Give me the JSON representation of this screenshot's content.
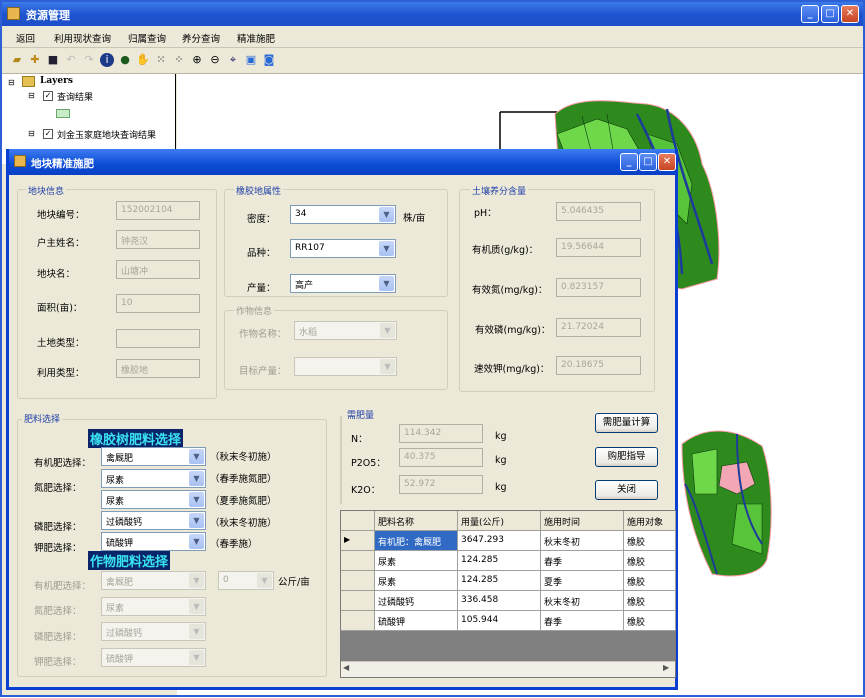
{
  "app": {
    "title": "资源管理"
  },
  "menu": [
    "返回",
    "利用现状查询",
    "归属查询",
    "养分查询",
    "精准施肥"
  ],
  "toc": {
    "root": "Layers",
    "layer1": "查询结果",
    "layer2": "刘金玉家庭地块查询结果"
  },
  "dialog": {
    "title": "地块精准施肥",
    "plot_info": {
      "group": "地块信息",
      "fields": [
        {
          "label": "地块编号：",
          "value": "152002104"
        },
        {
          "label": "户主姓名：",
          "value": "钟尧汉"
        },
        {
          "label": "地块名：",
          "value": "山塘冲"
        },
        {
          "label": "面积(亩)：",
          "value": "10"
        },
        {
          "label": "土地类型：",
          "value": ""
        },
        {
          "label": "利用类型：",
          "value": "橡胶地"
        }
      ]
    },
    "rubber": {
      "group": "橡胶地属性",
      "density": {
        "label": "密度：",
        "value": "34",
        "unit": "株/亩"
      },
      "variety": {
        "label": "品种：",
        "value": "RR107"
      },
      "yield": {
        "label": "产量：",
        "value": "高产"
      },
      "crop_group": "作物信息",
      "crop_name": {
        "label": "作物名称：",
        "value": "水稻"
      },
      "target_yield": {
        "label": "目标产量：",
        "value": ""
      }
    },
    "soil": {
      "group": "土壤养分含量",
      "fields": [
        {
          "label": "pH：",
          "value": "5.046435"
        },
        {
          "label": "有机质(g/kg)：",
          "value": "19.56644"
        },
        {
          "label": "有效氮(mg/kg)：",
          "value": "0.823157"
        },
        {
          "label": "有效磷(mg/kg)：",
          "value": "21.72024"
        },
        {
          "label": "速效钾(mg/kg)：",
          "value": "20.18675"
        }
      ]
    },
    "fert": {
      "group": "肥料选择",
      "rubber_header": "橡胶树肥料选择",
      "crop_header": "作物肥料选择",
      "rubber_rows": [
        {
          "label": "有机肥选择：",
          "value": "禽厩肥",
          "note": "（秋末冬初施）"
        },
        {
          "label": "氮肥选择：",
          "value": "尿素",
          "note": "（春季施氮肥）"
        },
        {
          "label": "",
          "value": "尿素",
          "note": "（夏季施氮肥）"
        },
        {
          "label": "磷肥选择：",
          "value": "过磷酸钙",
          "note": "（秋末冬初施）"
        },
        {
          "label": "钾肥选择：",
          "value": "硫酸钾",
          "note": "（春季施）"
        }
      ],
      "crop_rows": [
        {
          "label": "有机肥选择：",
          "value": "禽厩肥"
        },
        {
          "label": "氮肥选择：",
          "value": "尿素"
        },
        {
          "label": "磷肥选择：",
          "value": "过磷酸钙"
        },
        {
          "label": "钾肥选择：",
          "value": "硫酸钾"
        }
      ],
      "crop_amount": {
        "value": "0",
        "unit": "公斤/亩"
      }
    },
    "need": {
      "group": "需肥量",
      "rows": [
        {
          "label": "N：",
          "value": "114.342",
          "unit": "kg"
        },
        {
          "label": "P2O5：",
          "value": "40.375",
          "unit": "kg"
        },
        {
          "label": "K2O：",
          "value": "52.972",
          "unit": "kg"
        }
      ]
    },
    "buttons": {
      "calc": "需肥量计算",
      "buy": "购肥指导",
      "close": "关闭"
    },
    "table": {
      "headers": [
        "肥料名称",
        "用量(公斤)",
        "施用时间",
        "施用对象"
      ],
      "rows": [
        [
          "有机肥：禽厩肥",
          "3647.293",
          "秋末冬初",
          "橡胶"
        ],
        [
          "尿素",
          "124.285",
          "春季",
          "橡胶"
        ],
        [
          "尿素",
          "124.285",
          "夏季",
          "橡胶"
        ],
        [
          "过磷酸钙",
          "336.458",
          "秋末冬初",
          "橡胶"
        ],
        [
          "硫酸钾",
          "105.944",
          "春季",
          "橡胶"
        ]
      ]
    }
  }
}
